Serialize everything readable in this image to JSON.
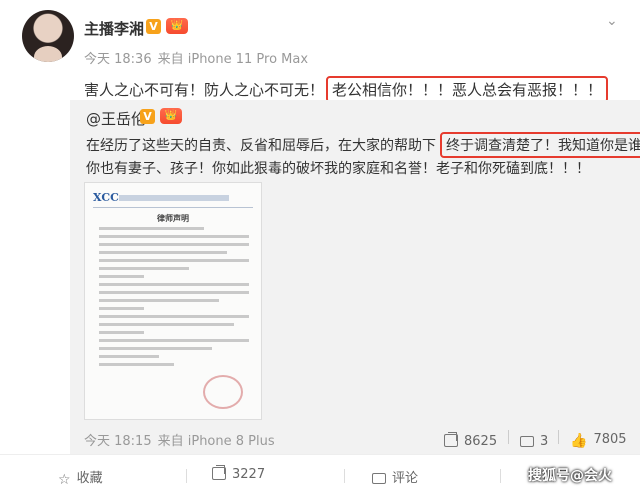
{
  "post": {
    "username": "主播李湘",
    "vip_badge": "V",
    "crown_badge": "👑",
    "time": "今天 18:36",
    "source": "来自 iPhone 11 Pro Max",
    "text_plain": "害人之心不可有！防人之心不可无！",
    "text_highlight": "老公相信你！！！恶人总会有恶报！！！"
  },
  "repost": {
    "username": "@王岳伦",
    "vip_badge": "V",
    "crown_badge": "👑",
    "line1_plain": "在经历了这些天的自责、反省和屈辱后，在大家的帮助下",
    "line1_highlight": "终于调查清楚了！我知道你是谁！",
    "line2": "你也有妻子、孩子！你如此狠毒的破坏我的家庭和名誉！老子和你死磕到底！！！",
    "doc": {
      "logo_mark": "XCC",
      "heading": "律师声明"
    },
    "time": "今天 18:15",
    "source": "来自 iPhone 8 Plus",
    "actions": {
      "share": "8625",
      "comment": "3",
      "like": "7805"
    }
  },
  "bottom_bar": {
    "favorite": "收藏",
    "share": "3227",
    "comment": "评论"
  },
  "watermark": "搜狐号@会火"
}
